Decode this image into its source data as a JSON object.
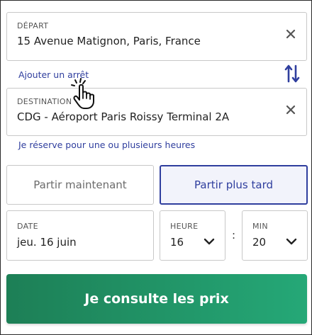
{
  "departure": {
    "label": "DÉPART",
    "value": "15 Avenue Matignon, Paris, France"
  },
  "add_stop_label": "Ajouter un arrêt",
  "destination": {
    "label": "DESTINATION",
    "value": "CDG - Aéroport Paris Roissy Terminal 2A"
  },
  "hourly_booking_label": "Je réserve pour une ou plusieurs heures",
  "timing": {
    "now_label": "Partir maintenant",
    "later_label": "Partir plus tard",
    "selected": "later"
  },
  "date": {
    "label": "DATE",
    "value": "jeu. 16 juin"
  },
  "hour": {
    "label": "HEURE",
    "value": "16"
  },
  "separator": ":",
  "minute": {
    "label": "MIN",
    "value": "20"
  },
  "cta_label": "Je consulte les prix",
  "colors": {
    "accent": "#2f3e9e",
    "cta_start": "#1d7f56",
    "cta_end": "#25a877",
    "border": "#c8c8c8"
  },
  "icons": [
    "clear-icon",
    "swap-icon",
    "chevron-down-icon",
    "hand-pointer-cursor"
  ]
}
